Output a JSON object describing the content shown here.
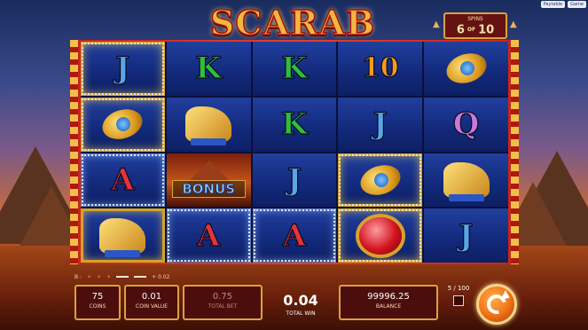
{
  "topbar": {
    "links": [
      "Paytable",
      "Game"
    ]
  },
  "game": {
    "title": "SCARAB"
  },
  "spins": {
    "label": "SPINS",
    "current": "6",
    "of": "OF",
    "total": "10"
  },
  "reels": [
    [
      {
        "type": "J",
        "win": true,
        "gold": true
      },
      {
        "type": "scarab",
        "win": true,
        "gold": true
      },
      {
        "type": "A",
        "win": true
      },
      {
        "type": "cat",
        "win": false,
        "gold": true
      }
    ],
    [
      {
        "type": "K"
      },
      {
        "type": "cat"
      },
      {
        "type": "bonus"
      },
      {
        "type": "A",
        "win": true
      }
    ],
    [
      {
        "type": "K"
      },
      {
        "type": "K"
      },
      {
        "type": "J"
      },
      {
        "type": "A",
        "win": true
      }
    ],
    [
      {
        "type": "10"
      },
      {
        "type": "J"
      },
      {
        "type": "scarab",
        "win": true,
        "gold": true
      },
      {
        "type": "gem",
        "win": true,
        "gold": true
      }
    ],
    [
      {
        "type": "scarab"
      },
      {
        "type": "Q"
      },
      {
        "type": "cat"
      },
      {
        "type": "J"
      }
    ]
  ],
  "bonus_label": "BONUS",
  "selection": {
    "prefix": "B :",
    "suffix": "+ 0.02"
  },
  "hud": {
    "coins": {
      "value": "75",
      "label": "COINS"
    },
    "coin_value": {
      "value": "0.01",
      "label": "COIN VALUE"
    },
    "total_bet": {
      "value": "0.75",
      "label": "TOTAL BET"
    },
    "total_win": {
      "value": "0.04",
      "label": "TOTAL WIN"
    },
    "balance": {
      "value": "99996.25",
      "label": "BALANCE"
    },
    "autoplay": {
      "value": "5 / 100"
    }
  },
  "colors": {
    "accent": "#d9a33c",
    "frame": "#e7402a",
    "panel": "#4c0e0c",
    "spin": "#f07016"
  },
  "icons": {
    "spin": "spin-button-icon",
    "autoplay": "autoplay-checkbox"
  }
}
